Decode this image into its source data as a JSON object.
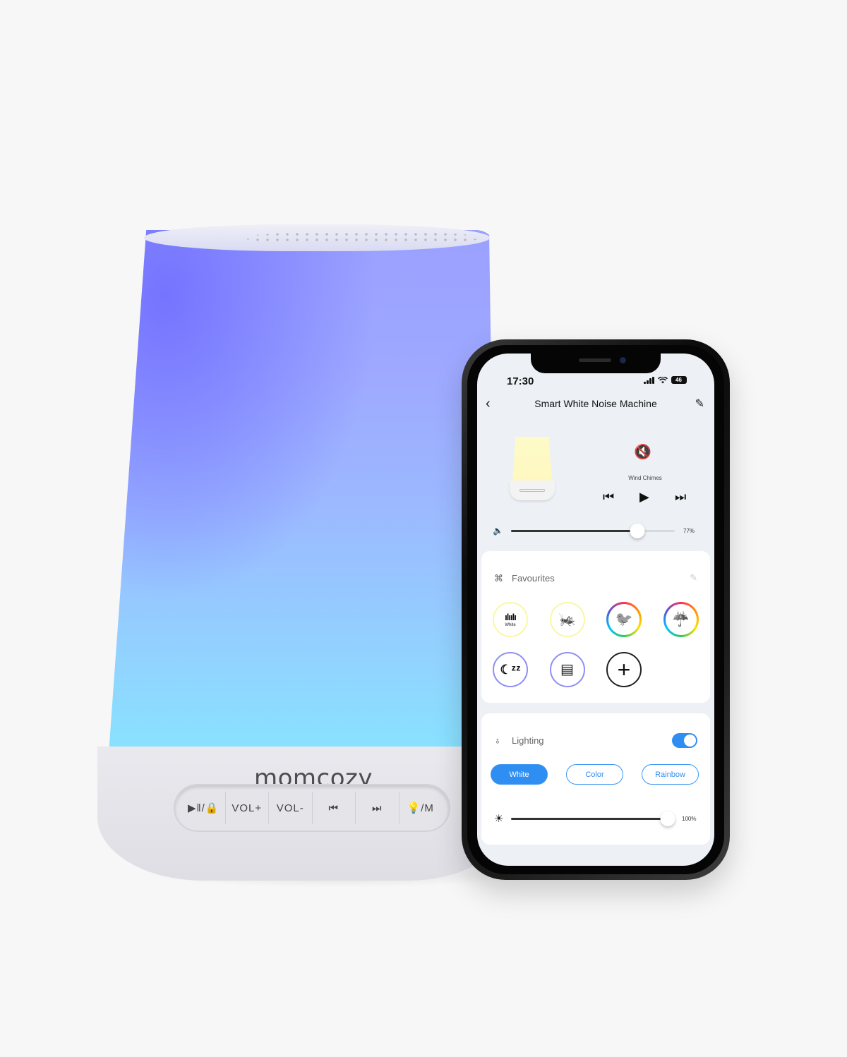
{
  "lamp": {
    "brand": "momcozy",
    "buttons": [
      {
        "name": "play-pause-lock",
        "label": "▶‖/🔒"
      },
      {
        "name": "volume-up",
        "label": "VOL+"
      },
      {
        "name": "volume-down",
        "label": "VOL-"
      },
      {
        "name": "previous",
        "label": "⏮"
      },
      {
        "name": "next",
        "label": "⏭"
      },
      {
        "name": "light-mode",
        "label": "💡/M"
      }
    ],
    "glow_colors": {
      "top": "#7474ff",
      "bottom": "#86e6ff"
    }
  },
  "phone": {
    "status_bar": {
      "time": "17:30",
      "battery": "46"
    },
    "header": {
      "back_icon": "‹",
      "title": "Smart White Noise Machine",
      "edit_icon": "✎"
    },
    "player": {
      "mute_icon": "🔇",
      "track": "Wind Chimes",
      "prev_icon": "⏮",
      "play_icon": "▶",
      "next_icon": "⏭",
      "volume_icon": "🔈",
      "volume_percent": 77,
      "volume_label": "77%"
    },
    "favourites": {
      "title": "Favourites",
      "items": [
        {
          "name": "white-noise",
          "glyph": "ılıılı",
          "label": "White",
          "ring": "yellow"
        },
        {
          "name": "cricket",
          "glyph": "🦗",
          "label": "",
          "ring": "yellow"
        },
        {
          "name": "bird",
          "glyph": "🐦",
          "label": "",
          "ring": "rainbow"
        },
        {
          "name": "rain",
          "glyph": "☔",
          "label": "",
          "ring": "rainbow"
        },
        {
          "name": "lullaby-moon",
          "glyph": "☾ᶻᶻ",
          "label": "",
          "ring": "blue"
        },
        {
          "name": "rain-on-awning",
          "glyph": "▤",
          "label": "",
          "ring": "blue"
        },
        {
          "name": "add-favourite",
          "glyph": "+",
          "label": "",
          "ring": "black"
        }
      ]
    },
    "lighting": {
      "title": "Lighting",
      "enabled": true,
      "modes": [
        "White",
        "Color",
        "Rainbow"
      ],
      "selected_mode": "White",
      "brightness_percent": 100,
      "brightness_label": "100%",
      "accent_color": "#2f8ef2"
    }
  }
}
